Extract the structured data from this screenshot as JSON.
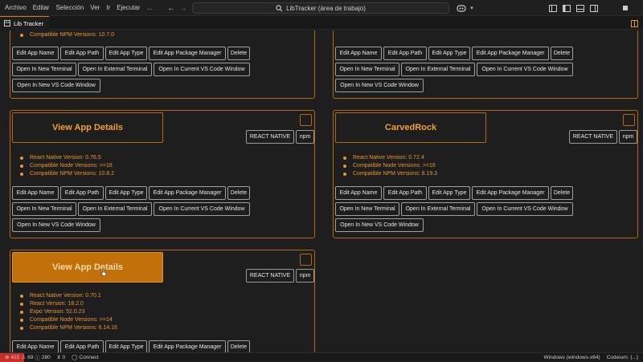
{
  "menu": [
    "Archivo",
    "Editar",
    "Selección",
    "Ver",
    "Ir",
    "Ejecutar",
    "..."
  ],
  "window": {
    "title": "LibTracker (área de trabajo)"
  },
  "tab": {
    "label": "Lib Tracker"
  },
  "buttons": {
    "edit_name": "Edit App Name",
    "edit_path": "Edit App Path",
    "edit_type": "Edit App Type",
    "edit_pm": "Edit App Package Manager",
    "delete": "Delete",
    "new_terminal": "Open In New Terminal",
    "external_terminal": "Open In External Terminal",
    "current_window": "Open In Current VS Code Window",
    "new_window": "Open In New VS Code Window"
  },
  "cards": [
    {
      "versions": [
        "Compatible NPM Versions: 10.7.0"
      ]
    },
    {
      "versions": []
    },
    {
      "name": "View App Details",
      "type": "REACT NATIVE",
      "pm": "npm",
      "versions": [
        "React Native Version: 0.76.5",
        "Compatible Node Versions: >=18",
        "Compatible NPM Versions: 10.8.2"
      ]
    },
    {
      "name": "CarvedRock",
      "type": "REACT NATIVE",
      "pm": "npm",
      "versions": [
        "React Native Version: 0.72.4",
        "Compatible Node Versions: >=16",
        "Compatible NPM Versions: 8.19.3"
      ]
    },
    {
      "name": "View App Details",
      "type": "REACT NATIVE",
      "pm": "npm",
      "versions": [
        "React Native Version: 0.70.1",
        "React Version: 18.2.0",
        "Expo Version: 52.0.23",
        "Compatible Node Versions: >=14",
        "Compatible NPM Versions: 6.14.16"
      ]
    }
  ],
  "status": {
    "errors": "415",
    "warnings": "69",
    "info": "280",
    "ports": "0",
    "connect": "Connect",
    "platform": "Windows (windows-x64)",
    "codeium": "Codeium: {...}"
  },
  "colors": {
    "accent": "#e8962e",
    "border": "#b46a08",
    "active_button": "#c2700a",
    "background": "#1e1e1e"
  }
}
